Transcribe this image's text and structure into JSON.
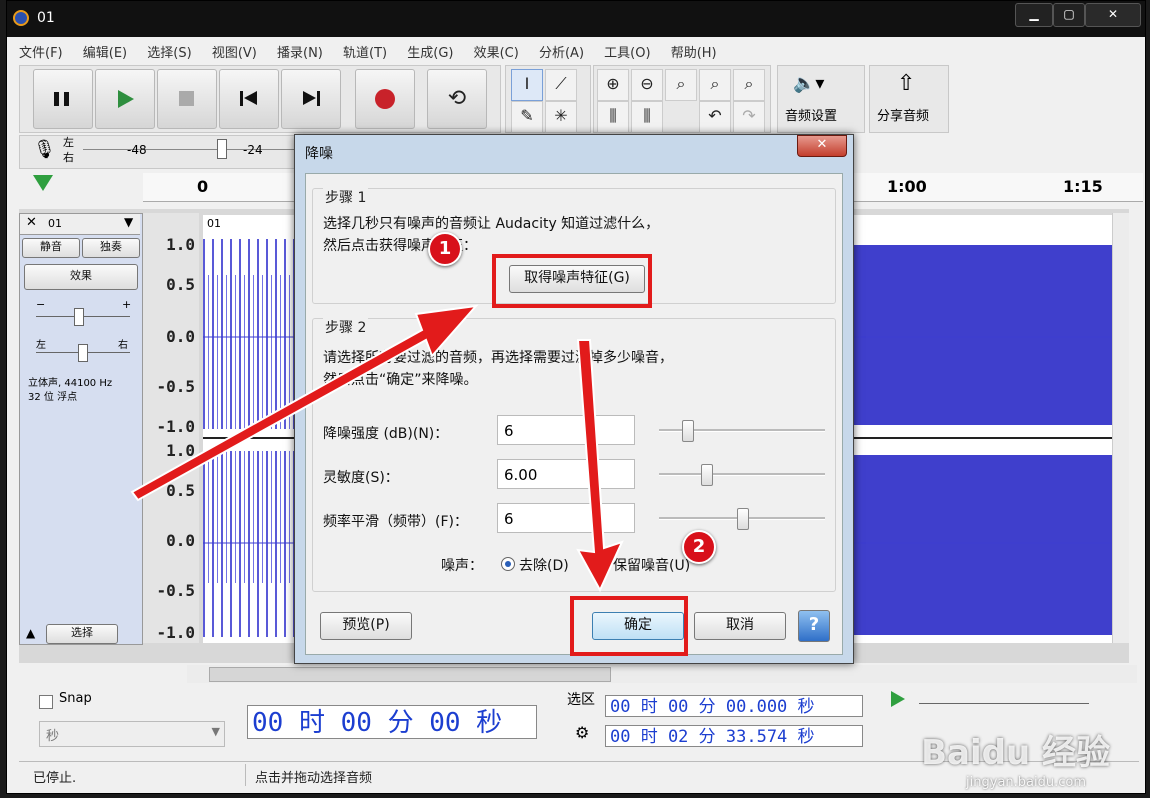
{
  "window": {
    "title": "01"
  },
  "menu": [
    "文件(F)",
    "编辑(E)",
    "选择(S)",
    "视图(V)",
    "播录(N)",
    "轨道(T)",
    "生成(G)",
    "效果(C)",
    "分析(A)",
    "工具(O)",
    "帮助(H)"
  ],
  "toolbar": {
    "audio_setup": "音频设置",
    "share_audio": "分享音频"
  },
  "meter": {
    "left": "左",
    "right": "右",
    "db48": "-48",
    "db24": "-24"
  },
  "ruler": {
    "t0": "0",
    "t60": "1:00",
    "t75": "1:15"
  },
  "track": {
    "name": "01",
    "mute": "静音",
    "solo": "独奏",
    "effects": "效果",
    "gain_minus": "−",
    "gain_plus": "+",
    "pan_left": "左",
    "pan_right": "右",
    "info1": "立体声, 44100 Hz",
    "info2": "32 位 浮点",
    "select": "选择",
    "clip_name": "01"
  },
  "scale": [
    "1.0",
    "0.5",
    "0.0",
    "-0.5",
    "-1.0",
    "1.0",
    "0.5",
    "0.0",
    "-0.5",
    "-1.0"
  ],
  "bottom": {
    "snap": "Snap",
    "seconds": "秒",
    "time_main": "00 时 00 分 00 秒",
    "selection": "选区",
    "sel_start": "00 时 00 分 00.000 秒",
    "sel_end": "00 时 02 分 33.574 秒"
  },
  "status": {
    "left": "已停止.",
    "right": "点击并拖动选择音频"
  },
  "dialog": {
    "title": "降噪",
    "close": "✕",
    "step1": "步骤 1",
    "step1_line1": "选择几秒只有噪声的音频让 Audacity 知道过滤什么，",
    "step1_line2": "然后点击获得噪声特征：",
    "get_profile": "取得噪声特征(G)",
    "step2": "步骤 2",
    "step2_line1": "请选择所有要过滤的音频，再选择需要过滤掉多少噪音，",
    "step2_line2": "然后点击“确定”来降噪。",
    "nr_label": "降噪强度 (dB)(N)：",
    "nr_value": "6",
    "nr_slider": 0.15,
    "sens_label": "灵敏度(S)：",
    "sens_value": "6.00",
    "sens_slider": 0.27,
    "smooth_label": "频率平滑（频带）(F)：",
    "smooth_value": "6",
    "smooth_slider": 0.5,
    "noise_label": "噪声：",
    "remove": "去除(D)",
    "keep": "保留噪音(U)",
    "preview": "预览(P)",
    "ok": "确定",
    "cancel": "取消",
    "help": "?"
  },
  "annotations": {
    "badge1": "1",
    "badge2": "2"
  },
  "watermark": {
    "brand": "Baidu 经验",
    "url": "jingyan.baidu.com"
  }
}
